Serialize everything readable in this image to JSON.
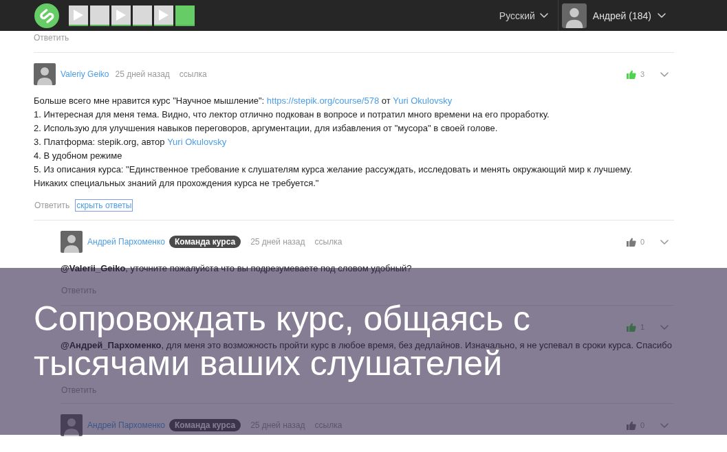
{
  "topbar": {
    "steps": [
      {
        "kind": "video",
        "passed": true,
        "selected": false
      },
      {
        "kind": "text",
        "passed": true,
        "selected": false
      },
      {
        "kind": "video",
        "passed": true,
        "selected": false
      },
      {
        "kind": "text",
        "passed": true,
        "selected": false
      },
      {
        "kind": "video",
        "passed": true,
        "selected": false
      },
      {
        "kind": "text",
        "passed": true,
        "selected": true
      }
    ],
    "language": "Русский",
    "user": "Андрей (184)"
  },
  "thread": {
    "previous_action": "Ответить",
    "comments": [
      {
        "author": "Valeriy Geiko",
        "time": "25 дней назад",
        "link": "ссылка",
        "votes": "3",
        "liked": true,
        "body": [
          {
            "segments": [
              {
                "kind": "text",
                "text": "Больше всего мне нравится курс \"Научное мышление\": "
              },
              {
                "kind": "link",
                "text": "https://stepik.org/course/578"
              },
              {
                "kind": "text",
                "text": " от "
              },
              {
                "kind": "link",
                "text": "Yuri Okulovsky"
              }
            ]
          },
          {
            "segments": [
              {
                "kind": "text",
                "text": "1. Интересная для меня тема. Видно, что лектор отлично подкован в вопросе и потратил много времени на его проработку."
              }
            ]
          },
          {
            "segments": [
              {
                "kind": "text",
                "text": "2. Использую для улучшения навыков переговоров, аргументации, для избавления от \"мусора\" в своей голове."
              }
            ]
          },
          {
            "segments": [
              {
                "kind": "text",
                "text": "3. Платформа: stepik.org, автор "
              },
              {
                "kind": "link",
                "text": "Yuri Okulovsky"
              }
            ]
          },
          {
            "segments": [
              {
                "kind": "text",
                "text": "4. В удобном режиме"
              }
            ]
          },
          {
            "segments": [
              {
                "kind": "text",
                "text": "5. Из описания курса: \"Единственное требование к слушателям курса желание рассуждать, исследовать и менять окружающий мир к лучшему. Никаких специальных знаний для прохождения курса не требуется.\""
              }
            ]
          }
        ],
        "actions": [
          {
            "kind": "reply",
            "label": "Ответить",
            "focused": false
          },
          {
            "kind": "toggle_replies",
            "label": "скрыть ответы",
            "focused": true
          }
        ],
        "replies": [
          {
            "author": "Андрей Пархоменко",
            "badge": "Команда курса",
            "time": "25 дней назад",
            "link": "ссылка",
            "votes": "0",
            "liked": false,
            "body": [
              {
                "segments": [
                  {
                    "kind": "text",
                    "text": "**@Valerii_Geiko**, уточните пожалуйста что вы подрезумеваете под словом удобный?"
                  }
                ]
              }
            ],
            "actions": [
              {
                "kind": "reply",
                "label": "Ответить",
                "focused": false
              }
            ]
          },
          {
            "votes": "1",
            "liked": true,
            "body": [
              {
                "segments": [
                  {
                    "kind": "text",
                    "text": "**@Андрей_Пархоменко**, для меня это возможность пройти курс в любое время, без дедлайнов. Изначально, я не успевал в сроки курса. Спасибо"
                  }
                ]
              }
            ],
            "actions": [
              {
                "kind": "reply",
                "label": "Ответить",
                "focused": false
              }
            ]
          },
          {
            "author": "Андрей Пархоменко",
            "badge": "Команда курса",
            "time": "25 дней назад",
            "link": "ссылка",
            "votes": "0",
            "liked": false
          }
        ]
      }
    ]
  },
  "caption": [
    "Сопровождать курс, общаясь с",
    "тысячами ваших слушателей"
  ]
}
